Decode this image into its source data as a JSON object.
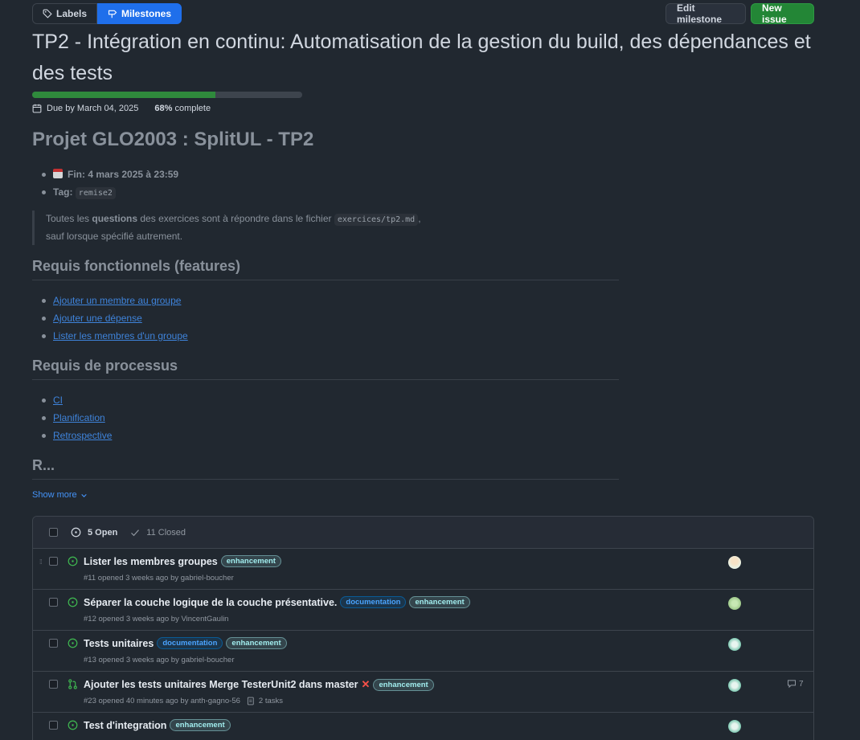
{
  "nav": {
    "labels_tab": "Labels",
    "milestones_tab": "Milestones"
  },
  "actions": {
    "edit_label": "Edit milestone",
    "new_label": "New issue"
  },
  "milestone": {
    "title": "TP2 - Intégration en continu: Automatisation de la gestion du build, des dépendances et des tests",
    "due": "Due by March 04, 2025",
    "percent": "68%",
    "percent_label": "complete",
    "progress_fraction": 0.68
  },
  "description": {
    "heading": "Projet GLO2003 : SplitUL - TP2",
    "fin_label": "Fin: 4 mars 2025 à 23:59",
    "tag_label": "Tag:",
    "tag_code": "remise2",
    "quote_pre": "Toutes les ",
    "quote_bold": "questions",
    "quote_mid": " des exercices sont à répondre dans le fichier ",
    "quote_code": "exercices/tp2.md",
    "quote_post": ",",
    "quote_line2": "sauf lorsque spécifié autrement.",
    "section1": "Requis fonctionnels (features)",
    "features": [
      "Ajouter un membre au groupe",
      "Ajouter une dépense",
      "Lister les membres d'un groupe"
    ],
    "section2": "Requis de processus",
    "process": [
      "CI",
      "Planification",
      "Retrospective"
    ],
    "section3": "R...",
    "show_more": "Show more"
  },
  "issues_header": {
    "open": "5 Open",
    "closed": "11 Closed"
  },
  "issues": [
    {
      "title": "Lister les membres groupes",
      "labels": [
        "enhancement"
      ],
      "meta": "#11 opened 3 weeks ago by gabriel-boucher",
      "type": "issue"
    },
    {
      "title": "Séparer la couche logique de la couche présentative.",
      "labels": [
        "documentation",
        "enhancement"
      ],
      "meta": "#12 opened 3 weeks ago by VincentGaulin",
      "type": "issue"
    },
    {
      "title": "Tests unitaires",
      "labels": [
        "documentation",
        "enhancement"
      ],
      "meta": "#13 opened 3 weeks ago by gabriel-boucher",
      "type": "issue"
    },
    {
      "title": "Ajouter les tests unitaires Merge TesterUnit2 dans master",
      "labels": [
        "enhancement"
      ],
      "meta": "#23 opened 40 minutes ago by anth-gagno-56",
      "tasks": "2 tasks",
      "comments": "7",
      "type": "pr"
    },
    {
      "title": "Test d'integration",
      "labels": [
        "enhancement"
      ],
      "meta": "",
      "type": "issue"
    }
  ],
  "colors": {
    "accent": "#1f6feb",
    "success": "#238636",
    "open_icon": "#3fb950",
    "fail": "#f85149"
  }
}
